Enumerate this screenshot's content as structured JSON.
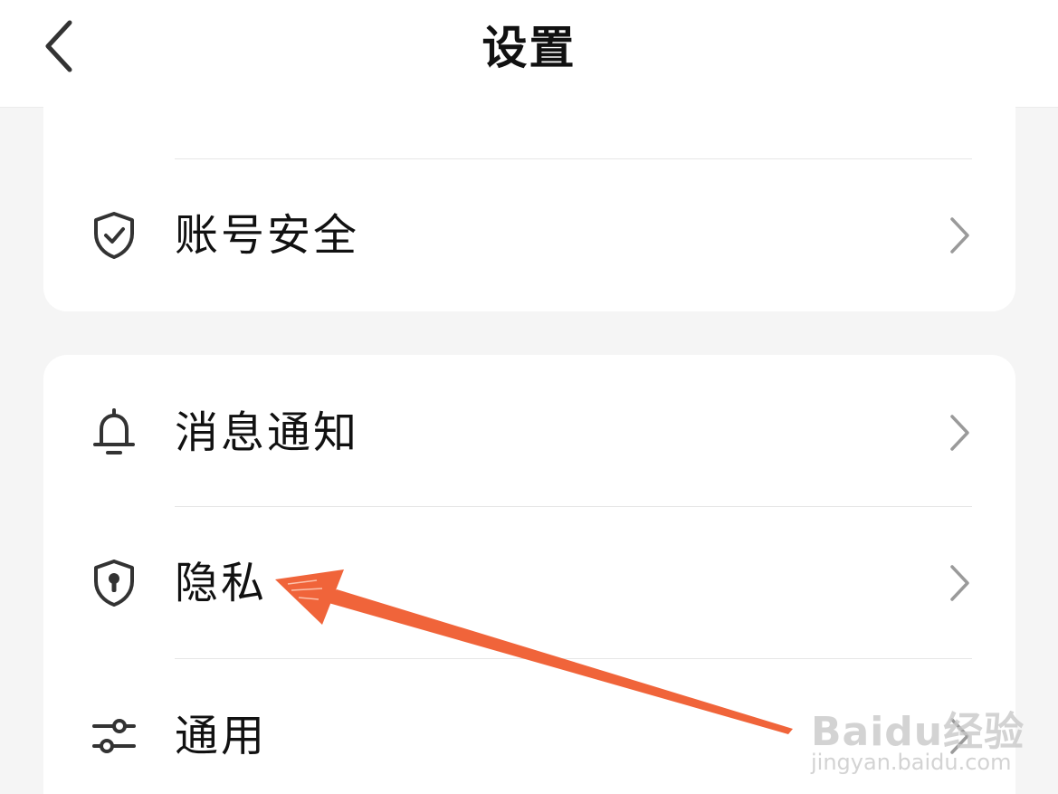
{
  "header": {
    "title": "设置",
    "back_icon": "chevron-left-icon"
  },
  "sections": [
    {
      "items": [
        {
          "label": "账号安全",
          "icon": "shield-check-icon"
        }
      ]
    },
    {
      "items": [
        {
          "label": "消息通知",
          "icon": "bell-icon"
        },
        {
          "label": "隐私",
          "icon": "shield-keyhole-icon"
        },
        {
          "label": "通用",
          "icon": "sliders-icon"
        }
      ]
    }
  ],
  "annotation": {
    "type": "arrow",
    "color": "#f0643a",
    "points_to": "隐私"
  },
  "watermark": {
    "brand": "Baidu经验",
    "url": "jingyan.baidu.com"
  },
  "colors": {
    "background": "#f5f5f5",
    "card": "#ffffff",
    "text": "#111111",
    "icon": "#333333",
    "chevron": "#9a9a9a",
    "divider": "#e6e6e6"
  }
}
